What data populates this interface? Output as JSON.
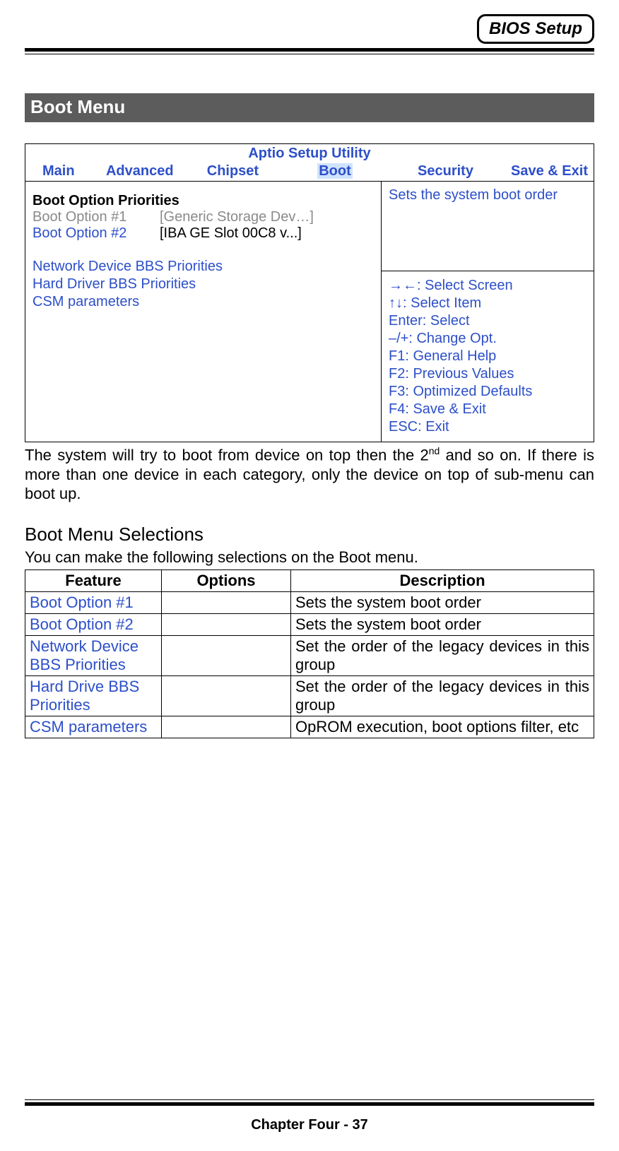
{
  "header": {
    "badge": "BIOS Setup"
  },
  "section_title": "Boot Menu",
  "bios": {
    "title": "Aptio Setup Utility",
    "tabs": {
      "main": "Main",
      "advanced": "Advanced",
      "chipset": "Chipset",
      "boot": "Boot",
      "security": "Security",
      "save_exit": "Save & Exit"
    },
    "left": {
      "priorities_header": "Boot Option Priorities",
      "opt1_label": "Boot Option #1",
      "opt1_value": "[Generic Storage Dev…]",
      "opt2_label": "Boot Option #2",
      "opt2_value": "[IBA GE Slot 00C8 v...]",
      "network_bbs": "Network Device BBS Priorities",
      "hard_bbs": "Hard Driver BBS Priorities",
      "csm": "CSM parameters"
    },
    "right": {
      "help_text": "Sets the system boot order",
      "keys": {
        "screen": "→←: Select Screen",
        "item": "↑↓: Select Item",
        "enter": "Enter: Select",
        "change": "–/+: Change Opt.",
        "f1": "F1: General Help",
        "f2": "F2: Previous Values",
        "f3": "F3: Optimized Defaults",
        "f4": "F4: Save & Exit",
        "esc": "ESC: Exit"
      }
    }
  },
  "paragraph": {
    "pre": "The system will try to boot from device on top then the 2",
    "sup": "nd",
    "post": " and so on. If there is more than one device in each category, only the device on top of sub-menu can boot up."
  },
  "selections": {
    "heading": "Boot Menu Selections",
    "lead": "You can make the following selections on the Boot menu.",
    "headers": {
      "feature": "Feature",
      "options": "Options",
      "description": "Description"
    },
    "rows": [
      {
        "feature": "Boot Option #1",
        "options": "",
        "description": "Sets the system boot order"
      },
      {
        "feature": "Boot Option #2",
        "options": "",
        "description": "Sets the system boot order"
      },
      {
        "feature": "Network Device BBS Priorities",
        "options": "",
        "description": "Set the order of the legacy devices in this group"
      },
      {
        "feature": "Hard Drive BBS Priorities",
        "options": "",
        "description": "Set the order of the legacy devices in this group"
      },
      {
        "feature": "CSM parameters",
        "options": "",
        "description": "OpROM execution, boot options filter, etc"
      }
    ]
  },
  "footer": "Chapter Four - 37"
}
